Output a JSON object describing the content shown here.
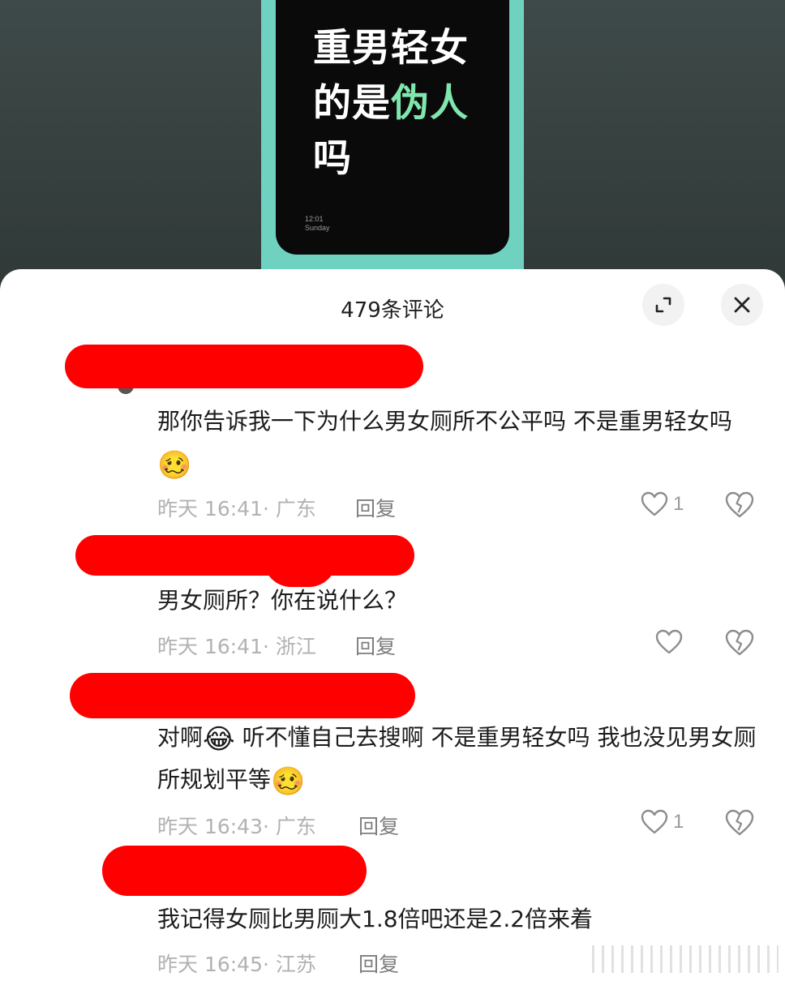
{
  "video_cover": {
    "title_line1": "重男轻女",
    "title_line2_prefix": "的是",
    "title_line2_highlight": "伪人",
    "title_line3": "吗",
    "time": "12:01",
    "day": "Sunday",
    "colors": {
      "frame": "#6fd2c1",
      "highlight": "#7fe6ad"
    }
  },
  "comments_header": {
    "title": "479条评论",
    "expand_icon": "expand-icon",
    "close_icon": "close-icon"
  },
  "comments": [
    {
      "text": "那你告诉我一下为什么男女厕所不公平吗 不是重男轻女吗",
      "emoji": "🥴",
      "meta": "昨天 16:41· 广东",
      "reply_label": "回复",
      "likes": "1"
    },
    {
      "text": "男女厕所？你在说什么？",
      "meta": "昨天 16:41· 浙江",
      "reply_label": "回复",
      "likes": ""
    },
    {
      "text_part1": "对啊",
      "emoji_mid": "😂",
      "text_part2": " 听不懂自己去搜啊 不是重男轻女吗 我也没见男女厕所规划平等",
      "emoji": "🥴",
      "meta": "昨天 16:43· 广东",
      "reply_label": "回复",
      "likes": "1"
    },
    {
      "text": "我记得女厕比男厕大1.8倍吧还是2.2倍来着",
      "meta": "昨天 16:45· 江苏",
      "reply_label": "回复"
    }
  ],
  "colors": {
    "redaction": "#ff0000",
    "meta": "#b2b2b2"
  }
}
